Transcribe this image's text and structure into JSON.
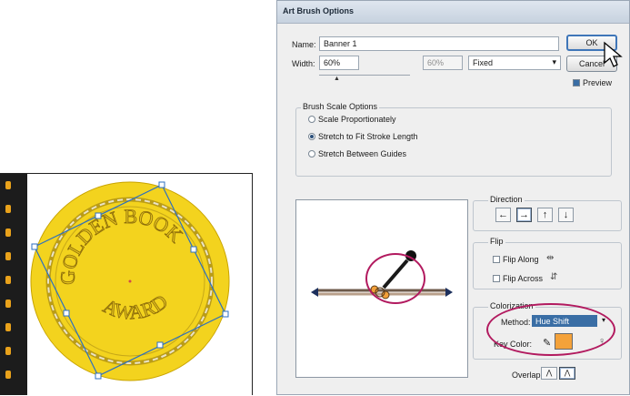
{
  "dialog": {
    "title": "Art Brush Options",
    "name_label": "Name:",
    "name_value": "Banner 1",
    "width_label": "Width:",
    "width_value": "60%",
    "width_variation_value": "60%",
    "width_mode": "Fixed",
    "ok_label": "OK",
    "cancel_label": "Cancel",
    "preview_label": "Preview",
    "preview_checked": true,
    "scale_group_title": "Brush Scale Options",
    "scale_options": [
      {
        "label": "Scale Proportionately",
        "selected": false
      },
      {
        "label": "Stretch to Fit Stroke Length",
        "selected": true
      },
      {
        "label": "Stretch Between Guides",
        "selected": false
      }
    ],
    "direction_title": "Direction",
    "direction_buttons": [
      {
        "icon": "arrow-left-icon",
        "glyph": "←",
        "selected": false
      },
      {
        "icon": "arrow-right-icon",
        "glyph": "→",
        "selected": true
      },
      {
        "icon": "arrow-up-icon",
        "glyph": "↑",
        "selected": false
      },
      {
        "icon": "arrow-down-icon",
        "glyph": "↓",
        "selected": false
      }
    ],
    "flip_title": "Flip",
    "flip_along_label": "Flip Along",
    "flip_across_label": "Flip Across",
    "colorization_title": "Colorization",
    "method_label": "Method:",
    "method_value": "Hue Shift",
    "key_color_label": "Key Color:",
    "key_color": "#f4a23a",
    "overlap_label": "Overlap:"
  },
  "artboard": {
    "medal_line1": "GOLDEN BOOK",
    "medal_line2": "AWARD"
  },
  "colors": {
    "medal_gold": "#f3d31e",
    "highlight_ring": "#b21a5f",
    "selection": "#2c6fc0"
  }
}
